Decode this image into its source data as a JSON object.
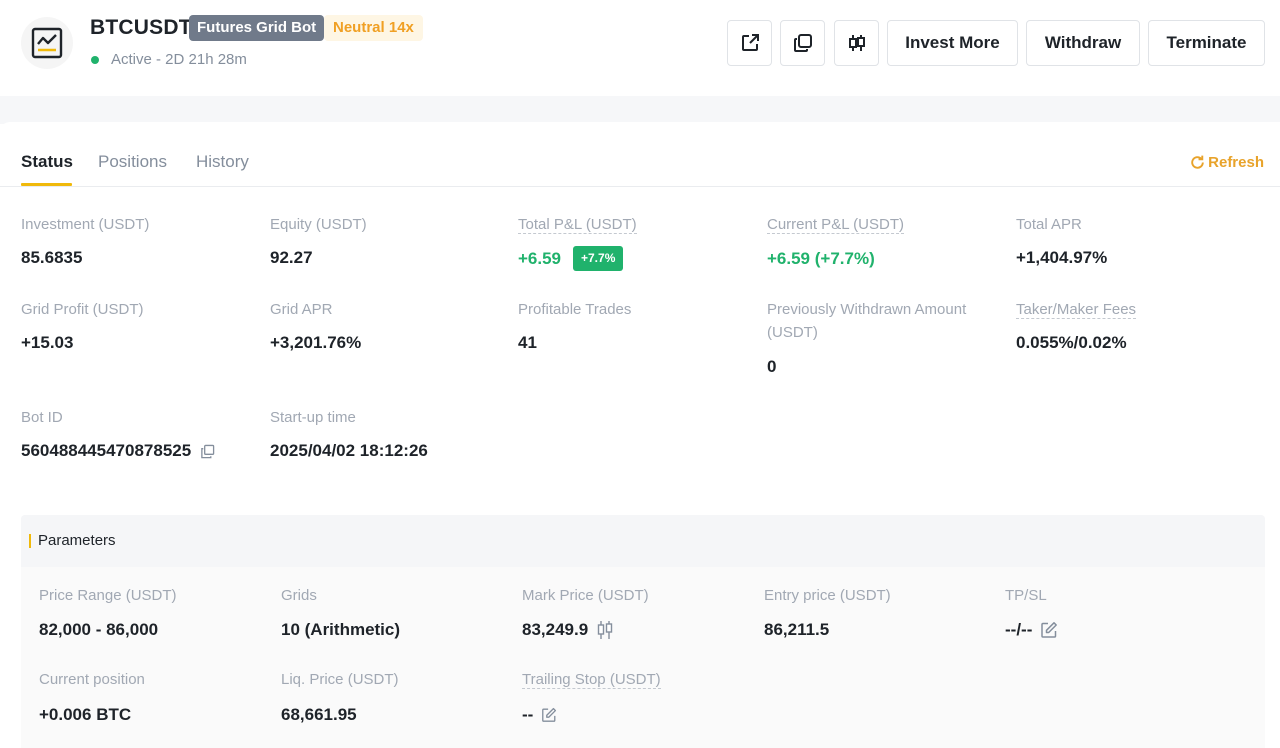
{
  "bot": {
    "symbol": "BTCUSDT",
    "type_badge": "Futures Grid Bot",
    "mode_badge": "Neutral 14x",
    "status": "Active - 2D 21h 28m",
    "logo_icon": "line-chart-icon"
  },
  "actions": {
    "share_icon": "external-link-icon",
    "copy_icon": "copy-icon",
    "chart_icon": "candlestick-icon",
    "invest_more": "Invest More",
    "withdraw": "Withdraw",
    "terminate": "Terminate"
  },
  "tabs": [
    {
      "label": "Status",
      "active": true
    },
    {
      "label": "Positions",
      "active": false
    },
    {
      "label": "History",
      "active": false
    }
  ],
  "refresh_label": "Refresh",
  "stats": {
    "investment": {
      "label": "Investment (USDT)",
      "value": "85.6835"
    },
    "equity": {
      "label": "Equity (USDT)",
      "value": "92.27"
    },
    "total_pl": {
      "label": "Total P&L (USDT)",
      "value": "+6.59",
      "badge": "+7.7%"
    },
    "current_pl": {
      "label": "Current P&L (USDT)",
      "value": "+6.59 (+7.7%)"
    },
    "total_apr": {
      "label": "Total APR",
      "value": "+1,404.97%"
    },
    "grid_profit": {
      "label": "Grid Profit (USDT)",
      "value": "+15.03"
    },
    "grid_apr": {
      "label": "Grid APR",
      "value": "+3,201.76%"
    },
    "profitable_trades": {
      "label": "Profitable Trades",
      "value": "41"
    },
    "prev_withdrawn": {
      "label": "Previously Withdrawn Amount (USDT)",
      "value": "0"
    },
    "fees": {
      "label": "Taker/Maker Fees",
      "value": "0.055%/0.02%"
    },
    "bot_id": {
      "label": "Bot ID",
      "value": "560488445470878525"
    },
    "startup": {
      "label": "Start-up time",
      "value": "2025/04/02 18:12:26"
    }
  },
  "parameters": {
    "title": "Parameters",
    "price_range": {
      "label": "Price Range (USDT)",
      "value": "82,000 - 86,000"
    },
    "grids": {
      "label": "Grids",
      "value": "10 (Arithmetic)"
    },
    "mark_price": {
      "label": "Mark Price (USDT)",
      "value": "83,249.9"
    },
    "entry_price": {
      "label": "Entry price (USDT)",
      "value": "86,211.5"
    },
    "tpsl": {
      "label": "TP/SL",
      "value": "--/--"
    },
    "current_position": {
      "label": "Current position",
      "value": "+0.006 BTC"
    },
    "liq_price": {
      "label": "Liq. Price (USDT)",
      "value": "68,661.95"
    },
    "trailing_stop": {
      "label": "Trailing Stop (USDT)",
      "value": "--"
    }
  },
  "colors": {
    "accent": "#f0b90b",
    "green": "#20b26c",
    "refresh": "#e8a32b",
    "badge_grey": "#707a8a"
  }
}
